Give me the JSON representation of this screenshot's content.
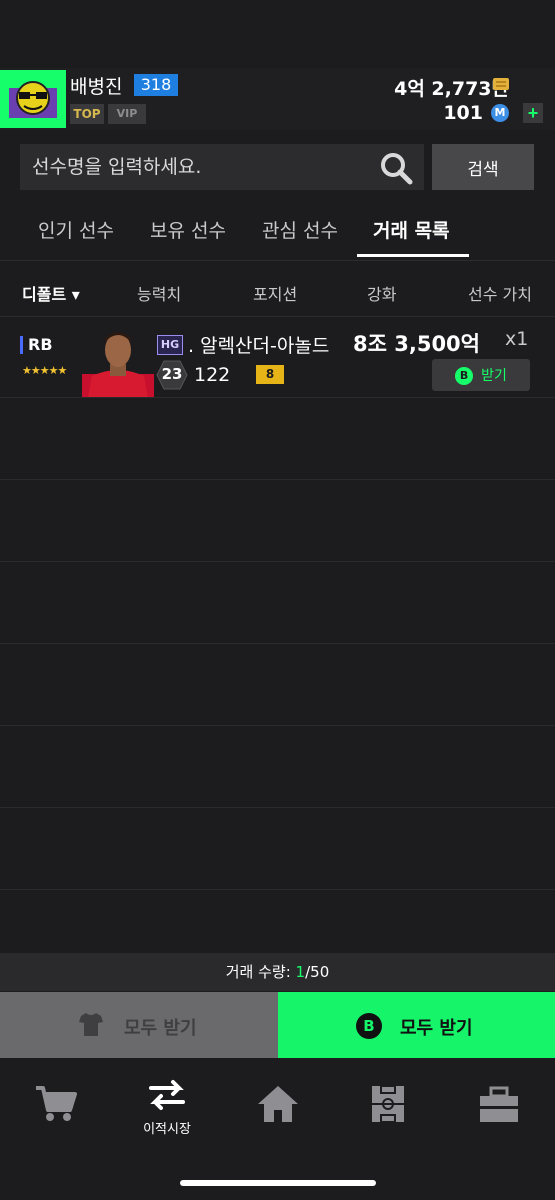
{
  "header": {
    "username": "배병진",
    "level": "318",
    "top_badge": "TOP",
    "vip_badge": "VIP",
    "currency": "4억 2,773만",
    "points": "101",
    "m_icon": "M",
    "plus": "+"
  },
  "search": {
    "placeholder": "선수명을 입력하세요.",
    "button_label": "검색"
  },
  "tabs": [
    {
      "label": "인기 선수",
      "active": false
    },
    {
      "label": "보유 선수",
      "active": false
    },
    {
      "label": "관심 선수",
      "active": false
    },
    {
      "label": "거래 목록",
      "active": true
    }
  ],
  "sort_columns": [
    {
      "label": "디폴트 ▾",
      "active": true
    },
    {
      "label": "능력치"
    },
    {
      "label": "포지션"
    },
    {
      "label": "강화"
    },
    {
      "label": "선수 가치"
    }
  ],
  "listings": [
    {
      "position": "RB",
      "stars": "★★★★★",
      "badge": "HG",
      "season": "23",
      "name": ". 알렉산더-아놀드",
      "price": "8조 3,500억",
      "quantity": "x1",
      "overall": "122",
      "enhancement": "8",
      "receive_icon": "B",
      "receive_label": "받기"
    }
  ],
  "trade_count": {
    "label": "거래 수량: ",
    "current": "1",
    "max": "/50"
  },
  "actions": {
    "receive_all_grey_label": "모두 받기",
    "receive_all_green_label": "모두 받기",
    "b_icon": "B"
  },
  "bottom_nav": {
    "active_label": "이적시장",
    "items": [
      "cart-icon",
      "transfer-icon",
      "home-icon",
      "field-icon",
      "briefcase-icon"
    ]
  },
  "colors": {
    "accent": "#16ff6b",
    "level_badge": "#1f7fe0",
    "enhancement_badge": "#e6b417"
  }
}
